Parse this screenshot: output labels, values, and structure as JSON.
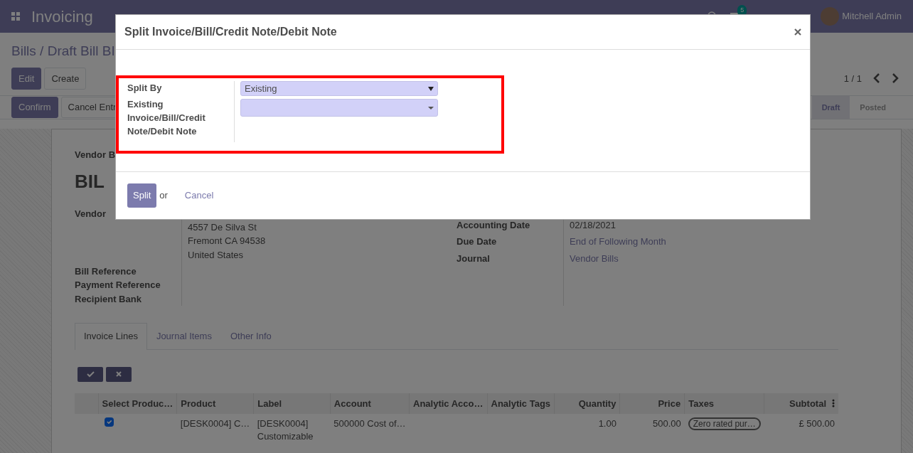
{
  "app": {
    "title": "Invoicing",
    "notification_count": "5",
    "user": "Mitchell Admin"
  },
  "breadcrumb": "Bills / Draft Bill BI",
  "buttons": [
    "Edit",
    "Create"
  ],
  "pager": "1 / 1",
  "actions": [
    "Confirm",
    "Cancel Entr"
  ],
  "stages": [
    {
      "label": "Draft",
      "selected": true
    },
    {
      "label": "Posted",
      "selected": false
    }
  ],
  "sheet": {
    "type_label": "Vendor B",
    "number": "BIL",
    "left_fields": [
      {
        "label": "Vendor",
        "lines": [
          "4557 De Silva St",
          "Fremont CA 94538",
          "United States"
        ]
      },
      {
        "label": "Bill Reference"
      },
      {
        "label": "Payment Reference"
      },
      {
        "label": "Recipient Bank"
      }
    ],
    "right_fields": [
      {
        "label": "Accounting Date",
        "value": "02/18/2021",
        "kind": "text"
      },
      {
        "label": "Due Date",
        "value": "End of Following Month",
        "kind": "link"
      },
      {
        "label": "Journal",
        "value": "Vendor Bills",
        "kind": "link"
      }
    ]
  },
  "tabs": [
    {
      "label": "Invoice Lines",
      "selected": true
    },
    {
      "label": "Journal Items",
      "selected": false
    },
    {
      "label": "Other Info",
      "selected": false
    }
  ],
  "table": {
    "columns": [
      {
        "label": "Select Produc…",
        "kind": "check"
      },
      {
        "label": "Product",
        "kind": "text"
      },
      {
        "label": "Label",
        "kind": "wrap"
      },
      {
        "label": "Account",
        "kind": "text"
      },
      {
        "label": "Analytic Acco…",
        "kind": "text"
      },
      {
        "label": "Analytic Tags",
        "kind": "text"
      },
      {
        "label": "Quantity",
        "kind": "number"
      },
      {
        "label": "Price",
        "kind": "number"
      },
      {
        "label": "Taxes",
        "kind": "tag"
      },
      {
        "label": "Subtotal",
        "kind": "number"
      }
    ],
    "rows": [
      {
        "checked": true,
        "cells": [
          "",
          "[DESK0004] C…",
          "[DESK0004] Customizable",
          "500000 Cost of…",
          "",
          "",
          "1.00",
          "500.00",
          "Zero rated pur…",
          "£ 500.00"
        ]
      }
    ]
  },
  "modal": {
    "title": "Split Invoice/Bill/Credit Note/Debit Note",
    "fields": [
      {
        "label": "Split By",
        "value": "Existing",
        "kind": "select"
      },
      {
        "label": "Existing Invoice/Bill/Credit Note/Debit Note",
        "kind": "many2one"
      }
    ],
    "primary": "Split",
    "or": "or",
    "cancel": "Cancel"
  }
}
